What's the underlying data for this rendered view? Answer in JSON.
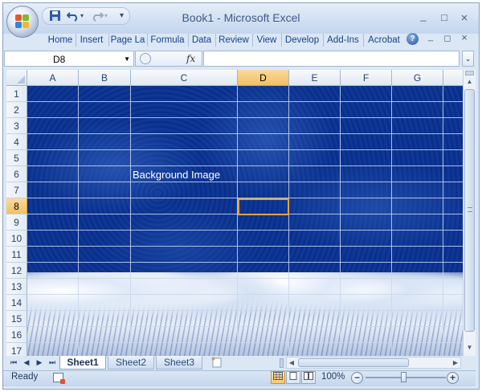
{
  "window": {
    "title": "Book1 - Microsoft Excel",
    "minimize_glyph": "_",
    "maximize_glyph": "□",
    "close_glyph": "×"
  },
  "quick_access": {
    "save_icon": "save-icon",
    "undo_icon": "undo-icon",
    "redo_icon": "redo-icon",
    "customize_glyph": "▾"
  },
  "ribbon": {
    "tabs": [
      "Home",
      "Insert",
      "Page La",
      "Formula",
      "Data",
      "Review",
      "View",
      "Develop",
      "Add-Ins",
      "Acrobat"
    ],
    "help_glyph": "?",
    "doc_minimize_glyph": "_",
    "doc_restore_glyph": "◻",
    "doc_close_glyph": "×"
  },
  "formula_bar": {
    "name_box": "D8",
    "fx_label": "fx",
    "formula_value": ""
  },
  "grid": {
    "columns": [
      "A",
      "B",
      "C",
      "D",
      "E",
      "F",
      "G"
    ],
    "rows": [
      "1",
      "2",
      "3",
      "4",
      "5",
      "6",
      "7",
      "8",
      "9",
      "10",
      "11",
      "12",
      "13",
      "14",
      "15",
      "16",
      "17"
    ],
    "selected_column": "D",
    "selected_row": "8",
    "cell_c5_text": "Background Image"
  },
  "sheets": {
    "tabs": [
      "Sheet1",
      "Sheet2",
      "Sheet3"
    ],
    "active": "Sheet1",
    "nav": [
      "⏮",
      "◀",
      "▶",
      "⏭"
    ]
  },
  "status": {
    "ready": "Ready",
    "zoom": "100%",
    "zoom_out": "−",
    "zoom_in": "+"
  },
  "colors": {
    "active_cell_border": "#e8a33c",
    "selected_header": "#f1c15f",
    "ribbon_text": "#15428b"
  }
}
